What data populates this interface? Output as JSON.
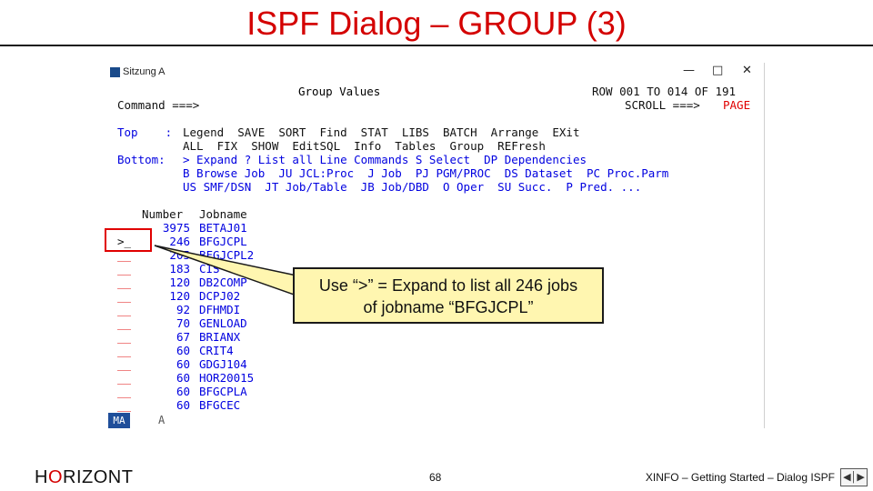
{
  "slide": {
    "title": "ISPF Dialog – GROUP (3)",
    "footer_logo_left": "H",
    "footer_logo_o": "O",
    "footer_logo_right": "RIZONT",
    "page_number": "68",
    "footer_text": "XINFO – Getting Started – Dialog ISPF",
    "nav_icon": "slide-nav-icon"
  },
  "terminal": {
    "window_title": "Sitzung A",
    "controls": {
      "minimize": "—",
      "maximize": "□",
      "close": "✕"
    },
    "panel_title": "Group Values",
    "row_info": "ROW 001 TO 014 OF 191",
    "command_label": "Command ===>",
    "scroll_label": "SCROLL ===>",
    "scroll_value": "PAGE",
    "legend_lines": [
      {
        "label": "Top    : ",
        "text": "Legend  SAVE  SORT  Find  STAT  LIBS  BATCH  Arrange  EXit"
      },
      {
        "label": "         ",
        "text": "ALL  FIX  SHOW  EditSQL  Info  Tables  Group  REFresh"
      },
      {
        "label": "Bottom: ",
        "text": "> Expand ? List all Line Commands S Select  DP Dependencies"
      },
      {
        "label": "         ",
        "text": "B Browse Job  JU JCL:Proc  J Job  PJ PGM/PROC  DS Dataset  PC Proc.Parm"
      },
      {
        "label": "         ",
        "text": "US SMF/DSN  JT Job/Table  JB Job/DBD  O Oper  SU Succ.  P Pred. ..."
      }
    ],
    "column_headers": {
      "number": "Number",
      "jobname": "Jobname"
    },
    "rows": [
      {
        "cmd": "",
        "number": "3975",
        "jobname": "BETAJ01"
      },
      {
        "cmd": ">_",
        "number": "246",
        "jobname": "BFGJCPL"
      },
      {
        "cmd": "__",
        "number": "205",
        "jobname": "BFGJCPL2"
      },
      {
        "cmd": "__",
        "number": "183",
        "jobname": "CIS"
      },
      {
        "cmd": "__",
        "number": "120",
        "jobname": "DB2COMP"
      },
      {
        "cmd": "__",
        "number": "120",
        "jobname": "DCPJ02"
      },
      {
        "cmd": "__",
        "number": "92",
        "jobname": "DFHMDI"
      },
      {
        "cmd": "__",
        "number": "70",
        "jobname": "GENLOAD"
      },
      {
        "cmd": "__",
        "number": "67",
        "jobname": "BRIANX"
      },
      {
        "cmd": "__",
        "number": "60",
        "jobname": "CRIT4"
      },
      {
        "cmd": "__",
        "number": "60",
        "jobname": "GDGJ104"
      },
      {
        "cmd": "__",
        "number": "60",
        "jobname": "HOR20015"
      },
      {
        "cmd": "__",
        "number": "60",
        "jobname": "BFGCPLA"
      },
      {
        "cmd": "__",
        "number": "60",
        "jobname": "BFGCEC"
      }
    ],
    "oia_mode": "MA",
    "oia_a": "A"
  },
  "callout": {
    "line1": "Use “>” = Expand to list all 246 jobs",
    "line2": "of jobname “BFGJCPL”"
  },
  "colors": {
    "title": "#d40000",
    "ispf_blue": "#0000e0",
    "ispf_red": "#e00000",
    "callout_bg": "#fff6b0"
  }
}
